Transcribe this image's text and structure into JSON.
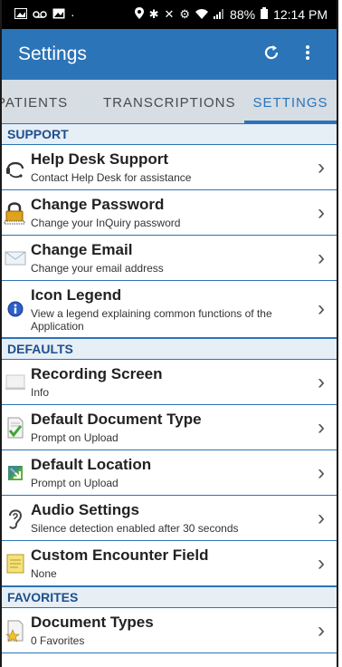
{
  "status_bar": {
    "battery": "88%",
    "time": "12:14 PM"
  },
  "app_bar": {
    "title": "Settings",
    "refresh_icon": "refresh-icon",
    "more_icon": "more-vert-icon"
  },
  "tabs": [
    {
      "label": "PATIENTS"
    },
    {
      "label": "TRANSCRIPTIONS"
    },
    {
      "label": "SETTINGS"
    }
  ],
  "sections": {
    "support": "SUPPORT",
    "defaults": "DEFAULTS",
    "favorites": "FAVORITES"
  },
  "support_items": [
    {
      "title": "Help Desk Support",
      "subtitle": "Contact Help Desk for assistance",
      "icon": "headset-icon"
    },
    {
      "title": "Change Password",
      "subtitle": "Change your InQuiry password",
      "icon": "lock-icon"
    },
    {
      "title": "Change Email",
      "subtitle": "Change your email address",
      "icon": "envelope-icon"
    },
    {
      "title": "Icon Legend",
      "subtitle": "View a legend explaining common functions of the Application",
      "icon": "info-icon"
    }
  ],
  "default_items": [
    {
      "title": "Recording Screen",
      "subtitle": "Info",
      "icon": "screen-icon"
    },
    {
      "title": "Default Document Type",
      "subtitle": "Prompt on Upload",
      "icon": "document-check-icon"
    },
    {
      "title": "Default Location",
      "subtitle": "Prompt on Upload",
      "icon": "location-arrow-icon"
    },
    {
      "title": "Audio Settings",
      "subtitle": "Silence detection enabled after 30 seconds",
      "icon": "ear-icon"
    },
    {
      "title": "Custom Encounter Field",
      "subtitle": "None",
      "icon": "note-icon"
    }
  ],
  "favorite_items": [
    {
      "title": "Document Types",
      "subtitle": "0 Favorites",
      "icon": "document-star-icon"
    }
  ],
  "colors": {
    "accent": "#2b74b8",
    "tab_bar": "#d6dde3",
    "section_bg": "#e6eef6"
  }
}
